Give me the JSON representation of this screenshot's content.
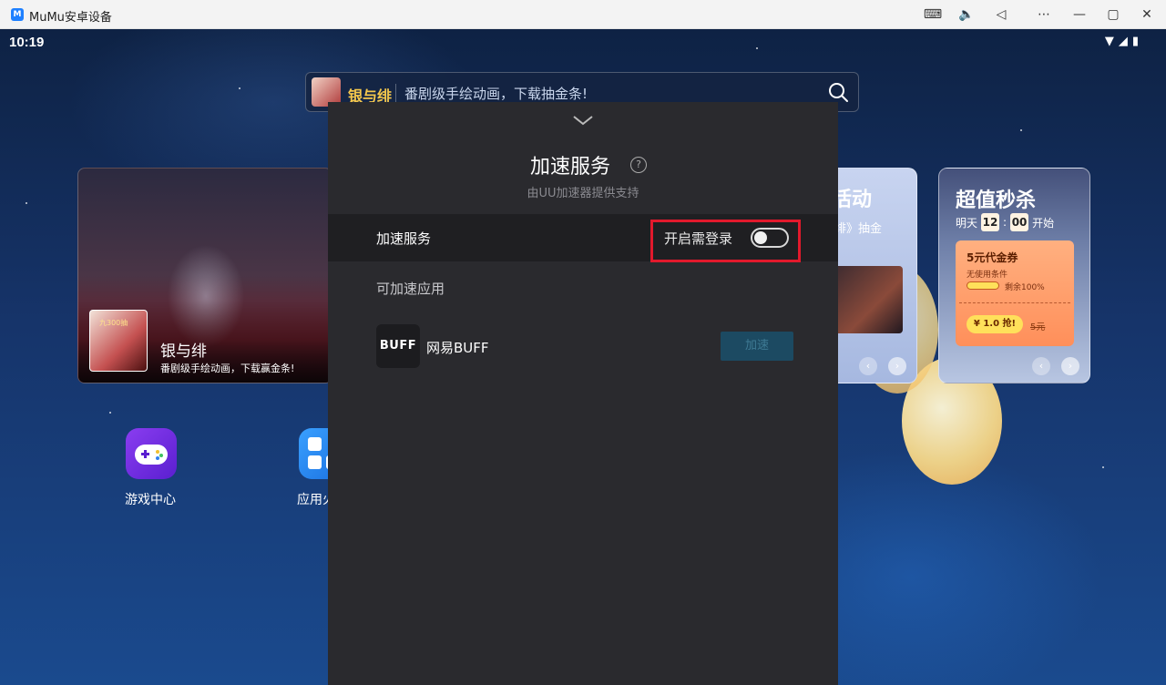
{
  "window": {
    "title": "MuMu安卓设备",
    "logo_text": "M",
    "controls": {
      "keyboard": "⌨",
      "volume": "🔈",
      "back": "◁",
      "more": "⋯",
      "minimize": "—",
      "maximize": "▢",
      "close": "✕"
    }
  },
  "status_bar": {
    "time": "10:19",
    "wifi": "▼",
    "signal": "◢",
    "battery": "▮"
  },
  "search": {
    "game_name": "银与绯",
    "promo_text": "番剧级手绘动画，下载抽金条!"
  },
  "banner": {
    "game_name": "银与绯",
    "subtitle": "番剧级手绘动画，下载赢金条!",
    "thumb_tag": "九300抽"
  },
  "activity_card": {
    "title": "活动",
    "subtitle": "绯》抽金",
    "prev": "‹",
    "next": "›"
  },
  "sale_card": {
    "title": "超值秒杀",
    "day": "明天",
    "hour": "12",
    "colon": ":",
    "minute": "00",
    "start": "开始",
    "coupon_title": "5元代金券",
    "coupon_condition": "无使用条件",
    "coupon_remaining": "剩余100%",
    "buy_label": "¥ 1.0 抢!",
    "original_price": "5元",
    "prev": "‹",
    "next": "›"
  },
  "desktop": {
    "icons": [
      {
        "label": "游戏中心"
      },
      {
        "label": "应用火"
      }
    ]
  },
  "panel": {
    "title": "加速服务",
    "help": "?",
    "subtitle": "由UU加速器提供支持",
    "row_label": "加速服务",
    "requires_login": "开启需登录",
    "toggle_on": false,
    "section_title": "可加速应用",
    "apps": [
      {
        "logo_text": "BUFF",
        "name": "网易BUFF",
        "button": "加速"
      }
    ]
  },
  "colors": {
    "panel_bg": "#2a2a2e",
    "row_bg": "#1f1f22",
    "highlight_box": "#e2192c",
    "accel_button_bg": "#1c4a62",
    "accel_button_text": "#3e7a94",
    "search_game_name": "#f5c84c"
  }
}
